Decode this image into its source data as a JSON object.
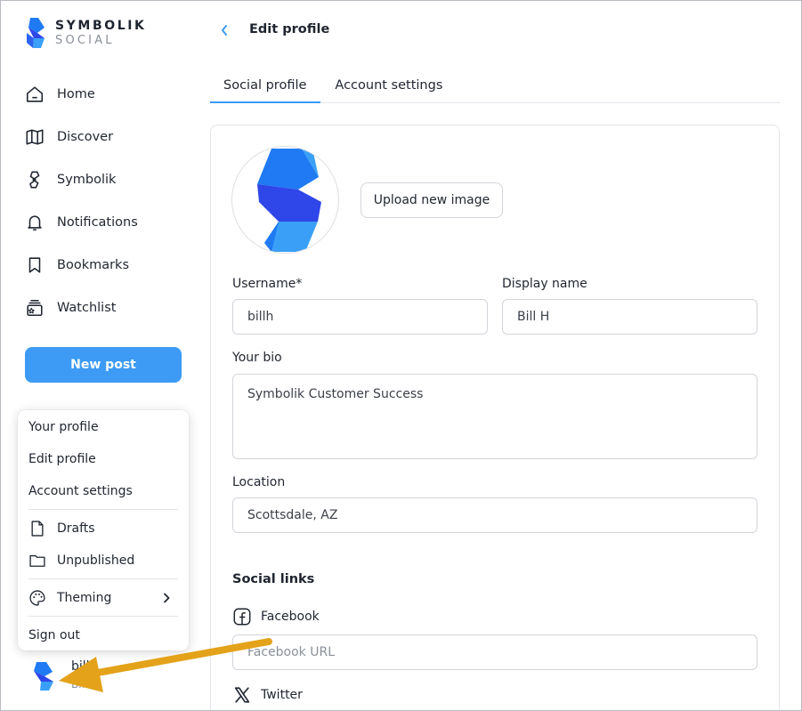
{
  "brand": {
    "line1": "SYMBOLIK",
    "line2": "SOCIAL",
    "accent": "#3d9bf5"
  },
  "nav": {
    "items": [
      {
        "label": "Home",
        "icon": "home-icon"
      },
      {
        "label": "Discover",
        "icon": "map-icon"
      },
      {
        "label": "Symbolik",
        "icon": "symbolik-icon"
      },
      {
        "label": "Notifications",
        "icon": "bell-icon"
      },
      {
        "label": "Bookmarks",
        "icon": "bookmark-icon"
      },
      {
        "label": "Watchlist",
        "icon": "watchlist-icon"
      }
    ],
    "new_post_label": "New post"
  },
  "user_menu": {
    "your_profile": "Your profile",
    "edit_profile": "Edit profile",
    "account_settings": "Account settings",
    "drafts": "Drafts",
    "unpublished": "Unpublished",
    "theming": "Theming",
    "sign_out": "Sign out"
  },
  "user": {
    "name": "bill",
    "handle": "Bill H"
  },
  "header": {
    "title": "Edit profile"
  },
  "tabs": [
    {
      "label": "Social profile",
      "active": true
    },
    {
      "label": "Account settings",
      "active": false
    }
  ],
  "profile": {
    "upload_label": "Upload new image",
    "username_label": "Username*",
    "username_value": "billh",
    "display_name_label": "Display name",
    "display_name_value": "Bill H",
    "bio_label": "Your bio",
    "bio_value": "Symbolik Customer Success",
    "location_label": "Location",
    "location_value": "Scottsdale, AZ"
  },
  "social_links": {
    "title": "Social links",
    "facebook_label": "Facebook",
    "facebook_placeholder": "Facebook URL",
    "twitter_label": "Twitter"
  },
  "annotation": {
    "arrow_color": "#e3a21a"
  }
}
